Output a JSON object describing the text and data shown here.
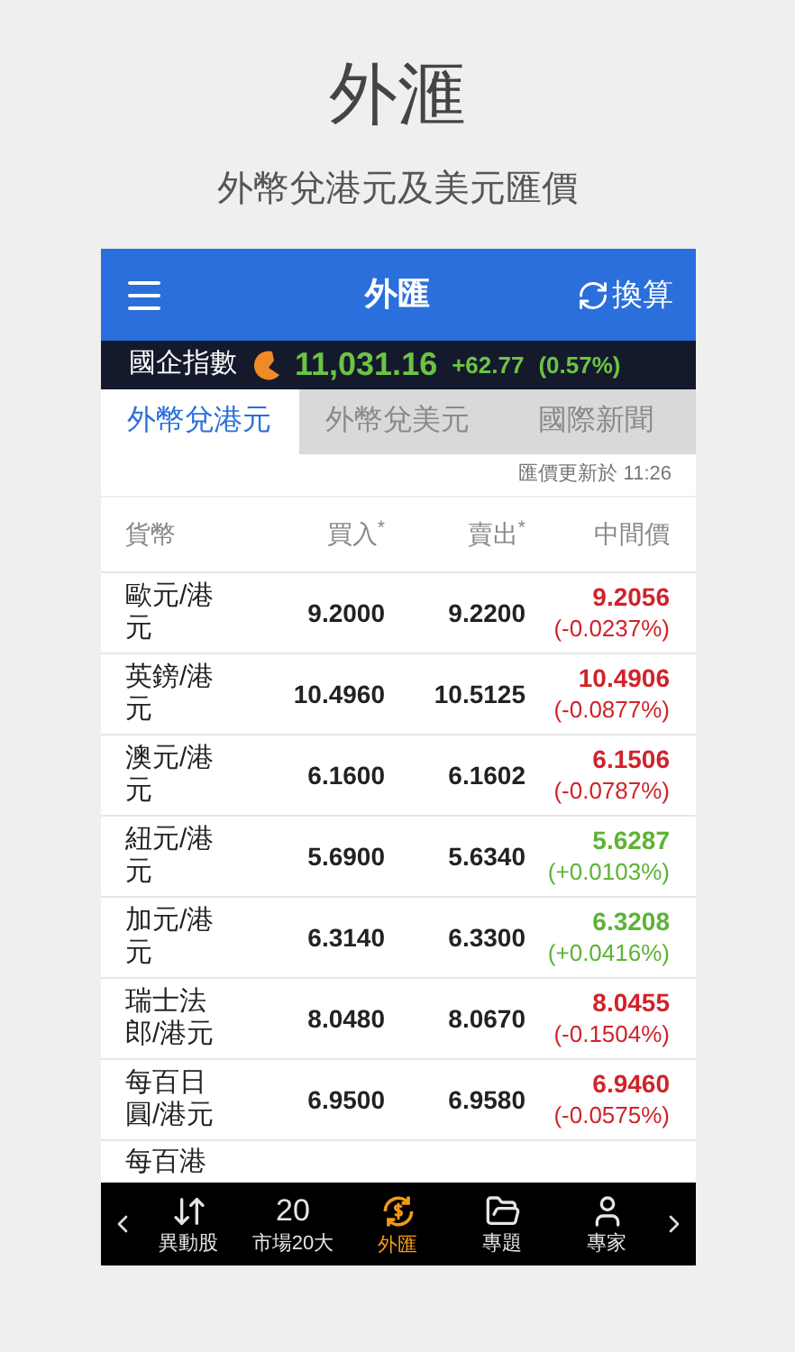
{
  "page_title": "外滙",
  "page_subtitle": "外幣兌港元及美元匯價",
  "app_header": {
    "title": "外匯",
    "convert_button": "換算"
  },
  "ticker": {
    "name": "國企指數",
    "value": "11,031.16",
    "change": "+62.77",
    "percent": "(0.57%)"
  },
  "tabs": [
    {
      "label": "外幣兌港元",
      "selected": true
    },
    {
      "label": "外幣兌美元",
      "selected": false
    },
    {
      "label": "國際新聞",
      "selected": false
    }
  ],
  "update_time": "匯價更新於 11:26",
  "table": {
    "columns": [
      {
        "label": "貨幣"
      },
      {
        "label": "買入",
        "mark": "*"
      },
      {
        "label": "賣出",
        "mark": "*"
      },
      {
        "label": "中間價"
      }
    ],
    "rows": [
      {
        "pair": "歐元/港元",
        "buy": "9.2000",
        "sell": "9.2200",
        "mid": "9.2056",
        "change": "(-0.0237%)",
        "color": "#d0232a"
      },
      {
        "pair": "英鎊/港元",
        "buy": "10.4960",
        "sell": "10.5125",
        "mid": "10.4906",
        "change": "(-0.0877%)",
        "color": "#d0232a"
      },
      {
        "pair": "澳元/港元",
        "buy": "6.1600",
        "sell": "6.1602",
        "mid": "6.1506",
        "change": "(-0.0787%)",
        "color": "#d0232a"
      },
      {
        "pair": "紐元/港元",
        "buy": "5.6900",
        "sell": "5.6340",
        "mid": "5.6287",
        "change": "(+0.0103%)",
        "color": "#5cb335"
      },
      {
        "pair": "加元/港元",
        "buy": "6.3140",
        "sell": "6.3300",
        "mid": "6.3208",
        "change": "(+0.0416%)",
        "color": "#5cb335"
      },
      {
        "pair": "瑞士法郎/港元",
        "buy": "8.0480",
        "sell": "8.0670",
        "mid": "8.0455",
        "change": "(-0.1504%)",
        "color": "#d0232a"
      },
      {
        "pair": "每百日圓/港元",
        "buy": "6.9500",
        "sell": "6.9580",
        "mid": "6.9460",
        "change": "(-0.0575%)",
        "color": "#d0232a"
      }
    ],
    "partial_row": "每百港"
  },
  "bottom_nav": [
    {
      "label": "異動股",
      "kind": "movers",
      "selected": false
    },
    {
      "label": "市場20大",
      "kind": "top20",
      "icon_text": "20",
      "selected": false
    },
    {
      "label": "外匯",
      "kind": "fx",
      "selected": true
    },
    {
      "label": "專題",
      "kind": "topics",
      "selected": false
    },
    {
      "label": "專家",
      "kind": "experts",
      "selected": false
    }
  ]
}
